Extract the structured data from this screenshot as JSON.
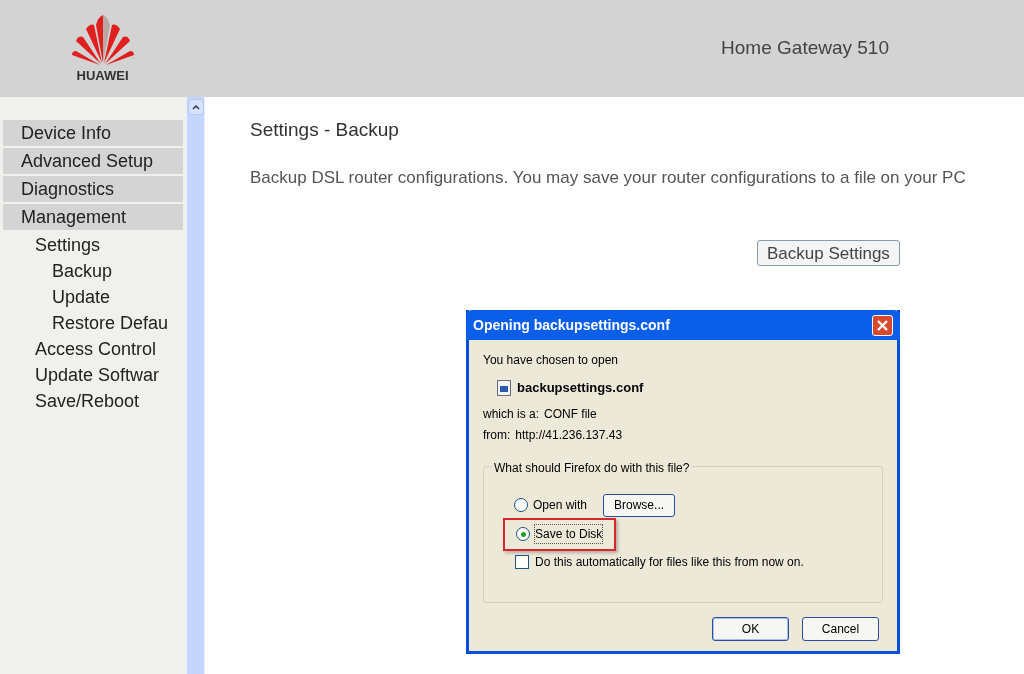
{
  "header": {
    "brand": "HUAWEI",
    "product": "Home Gateway 510"
  },
  "sidebar": {
    "items": [
      {
        "label": "Device Info"
      },
      {
        "label": "Advanced Setup"
      },
      {
        "label": "Diagnostics"
      },
      {
        "label": "Management",
        "children": [
          {
            "label": "Settings",
            "children": [
              {
                "label": "Backup"
              },
              {
                "label": "Update"
              },
              {
                "label": "Restore Defau"
              }
            ]
          },
          {
            "label": "Access Control"
          },
          {
            "label": "Update Softwar"
          },
          {
            "label": "Save/Reboot"
          }
        ]
      }
    ]
  },
  "main": {
    "title": "Settings - Backup",
    "description": "Backup DSL router configurations. You may save your router configurations to a file on your PC",
    "button": "Backup Settings"
  },
  "dialog": {
    "title": "Opening backupsettings.conf",
    "intro": "You have chosen to open",
    "file_name": "backupsettings.conf",
    "type_label": "which is a:",
    "type_value": "CONF file",
    "from_label": "from:",
    "from_value": "http://41.236.137.43",
    "group_title": "What should Firefox do with this file?",
    "options": [
      {
        "label": "Open with",
        "selected": false,
        "highlighted": false
      },
      {
        "label": "Save to Disk",
        "selected": true,
        "highlighted": true
      }
    ],
    "browse_button": "Browse...",
    "auto": {
      "label": "Do this automatically for files like this from now on.",
      "checked": false
    },
    "buttons": [
      "OK",
      "Cancel"
    ]
  }
}
